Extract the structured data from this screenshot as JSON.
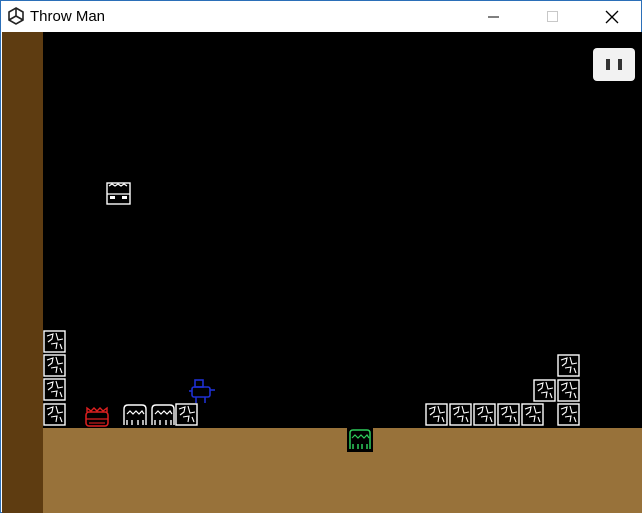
{
  "window": {
    "title": "Throw Man",
    "icon": "unity-logo-icon",
    "controls": [
      "minimize-icon",
      "maximize-icon",
      "close-icon"
    ]
  },
  "hud": {
    "pause_icon": "pause-icon"
  },
  "colors": {
    "sky": "#000000",
    "wall": "#5e3c11",
    "ground": "#98723a",
    "player": "#1f2fd0",
    "red_enemy": "#e02020",
    "green_enemy": "#2ecc5a",
    "tiles": "#ffffff",
    "pause_button": "#f2f2f2"
  }
}
